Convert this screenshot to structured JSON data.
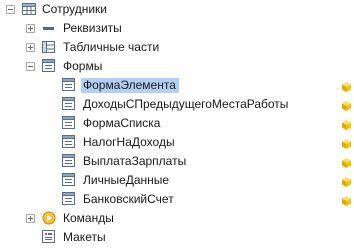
{
  "tree": {
    "root": {
      "label": "Сотрудники",
      "icon": "catalog-icon"
    },
    "requisites": {
      "label": "Реквизиты",
      "icon": "requisite-icon",
      "expander": "plus"
    },
    "tabular": {
      "label": "Табличные части",
      "icon": "table-icon",
      "expander": "plus"
    },
    "forms": {
      "label": "Формы",
      "icon": "form-folder-icon",
      "expander": "minus",
      "items": [
        {
          "label": "ФормаЭлемента",
          "selected": true
        },
        {
          "label": "ДоходыСПредыдущегоМестаРаботы",
          "selected": false
        },
        {
          "label": "ФормаСписка",
          "selected": false
        },
        {
          "label": "НалогНаДоходы",
          "selected": false
        },
        {
          "label": "ВыплатаЗарплаты",
          "selected": false
        },
        {
          "label": "ЛичныеДанные",
          "selected": false
        },
        {
          "label": "БанковскийСчет",
          "selected": false
        }
      ]
    },
    "commands": {
      "label": "Команды",
      "icon": "command-icon",
      "expander": "plus"
    },
    "layouts": {
      "label": "Макеты",
      "icon": "layout-icon"
    }
  },
  "colors": {
    "selection": "#b3d0f2",
    "cube": "#f2c400"
  }
}
